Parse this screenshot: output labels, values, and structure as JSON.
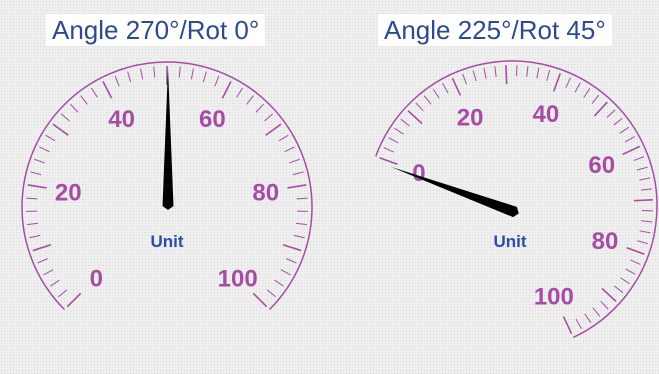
{
  "gauges": [
    {
      "title": "Angle 270°/Rot 0°",
      "unit": "Unit",
      "ticks": [
        "0",
        "20",
        "40",
        "60",
        "80",
        "100"
      ],
      "min": 0,
      "max": 100,
      "sweep_degrees": 270,
      "rotation_degrees": 0,
      "value": 50
    },
    {
      "title": "Angle 225°/Rot 45°",
      "unit": "Unit",
      "ticks": [
        "0",
        "20",
        "40",
        "60",
        "80",
        "100"
      ],
      "min": 0,
      "max": 100,
      "sweep_degrees": 225,
      "rotation_degrees": 45,
      "value": 0
    }
  ],
  "colors": {
    "scale": "#a64ca6",
    "needle": "#000000",
    "unit": "#2b4da8",
    "title": "#2e4a8f"
  }
}
